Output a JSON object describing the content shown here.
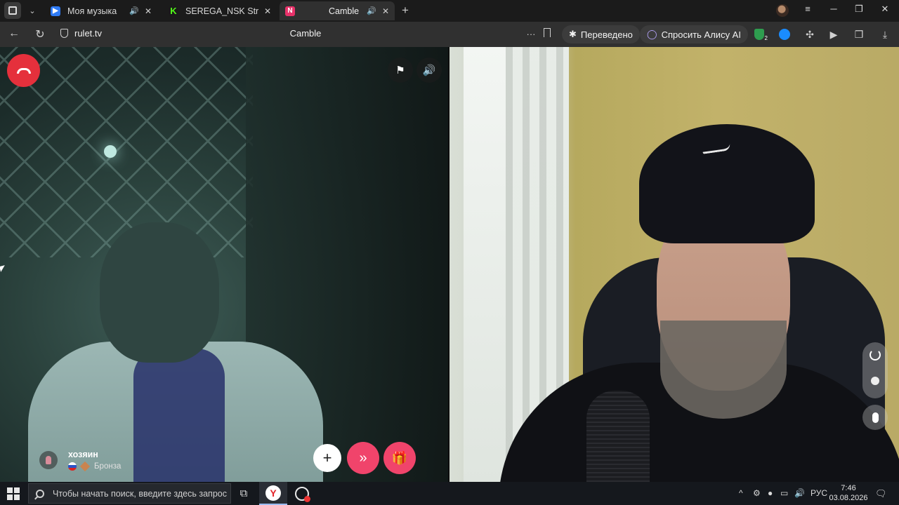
{
  "browser": {
    "tabs": [
      {
        "title": "Моя музыка",
        "audio": "🔊",
        "active": false
      },
      {
        "title": "SEREGA_NSK Stream - Wa",
        "audio": "",
        "active": false
      },
      {
        "title": "Camble",
        "audio": "🔊",
        "active": true
      }
    ],
    "close_glyph": "✕",
    "new_tab_glyph": "+",
    "menu_glyph": "≡",
    "minimize_glyph": "─",
    "restore_glyph": "❐",
    "window_close_glyph": "✕"
  },
  "addressbar": {
    "back_glyph": "←",
    "reload_glyph": "↻",
    "domain": "rulet.tv",
    "page_title": "Camble",
    "more_glyph": "···",
    "bookmark_glyph": "🔖",
    "translated_label": "Переведено",
    "alice_label": "Спросить Алису AI",
    "ext_badge": "2"
  },
  "call": {
    "flag_glyph": "⚑",
    "volume_glyph": "🔊",
    "user": {
      "name": "хозяин",
      "rank": "Бронза"
    },
    "add_glyph": "+",
    "next_glyph": "»",
    "gift_glyph": "🎁"
  },
  "taskbar": {
    "search_placeholder": "Чтобы начать поиск, введите здесь запрос",
    "yandex_glyph": "Y",
    "taskview_glyph": "⧉",
    "tray_up_glyph": "^",
    "lang": "РУС",
    "time": "7:46",
    "date": "03.08.2026",
    "notif_glyph": "🗨"
  },
  "colors": {
    "accent_pink": "#f0446b",
    "hangup_red": "#e5303c",
    "tab_active": "#303030"
  }
}
